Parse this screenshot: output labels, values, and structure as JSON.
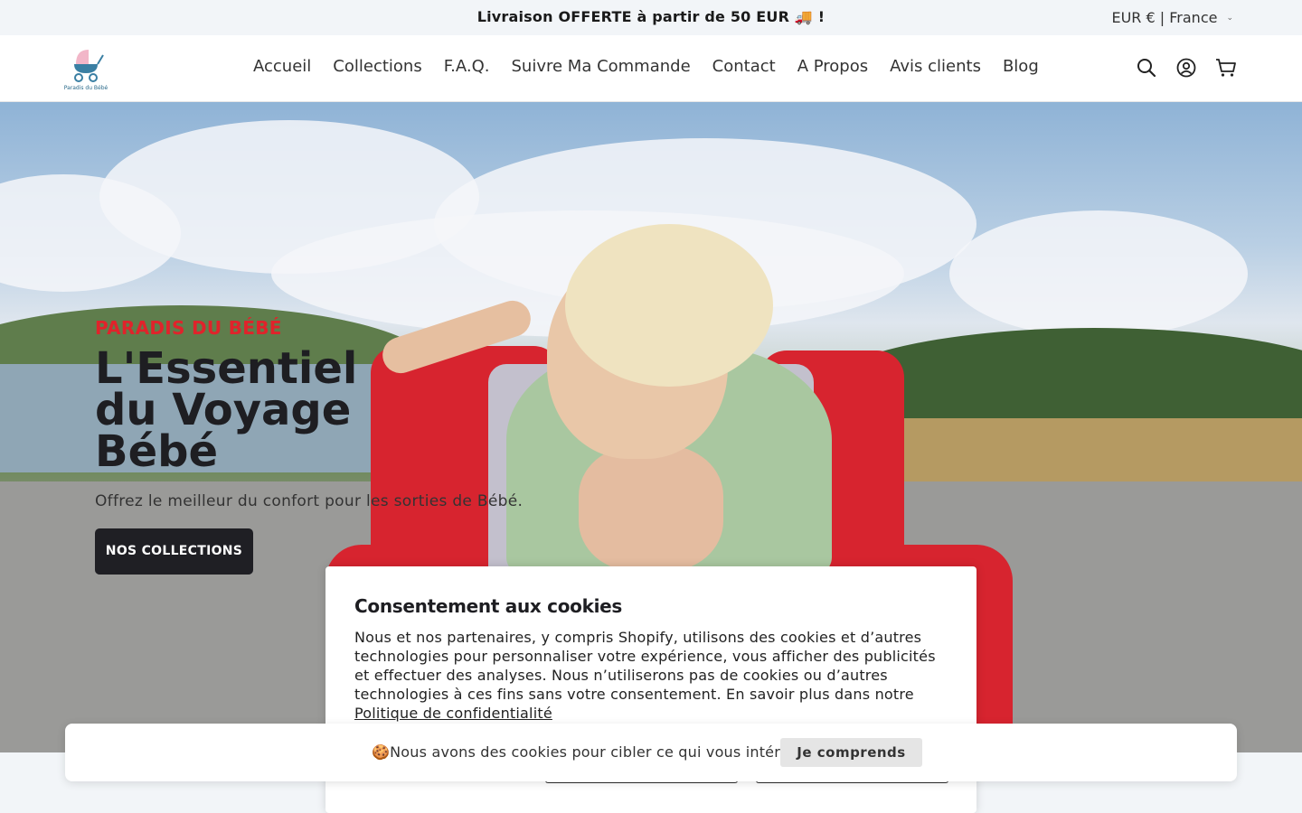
{
  "announcement": {
    "text": "Livraison OFFERTE à partir de 50 EUR 🚚 !",
    "currency_label": "EUR € | France"
  },
  "header": {
    "logo_text": "Paradis du Bébé",
    "nav": [
      {
        "label": "Accueil"
      },
      {
        "label": "Collections"
      },
      {
        "label": "F.A.Q."
      },
      {
        "label": "Suivre Ma Commande"
      },
      {
        "label": "Contact"
      },
      {
        "label": "A Propos"
      },
      {
        "label": "Avis clients"
      },
      {
        "label": "Blog"
      }
    ],
    "icons": [
      "search-icon",
      "account-icon",
      "cart-icon"
    ]
  },
  "hero": {
    "kicker": "PARADIS DU BÉBÉ",
    "title": "L'Essentiel du Voyage Bébé",
    "subtitle": "Offrez le meilleur du confort pour les sorties de Bébé.",
    "button_label": "NOS COLLECTIONS"
  },
  "consent": {
    "title": "Consentement aux cookies",
    "body": "Nous et nos partenaires, y compris Shopify, utilisons des cookies et d’autres technologies pour personnaliser votre expérience, vous afficher des publicités et effectuer des analyses. Nous n’utiliserons pas de cookies ou d’autres technologies à ces fins sans votre consentement. En savoir plus dans notre",
    "link": "Politique de confidentialité"
  },
  "cookiebar": {
    "text": "🍪Nous avons des cookies pour cibler ce qui vous intéresse.",
    "button_label": "Je comprends"
  },
  "colors": {
    "accent_red": "#e0232b",
    "dark_button": "#1f1f24",
    "announce_bg": "#f2f5f8"
  }
}
